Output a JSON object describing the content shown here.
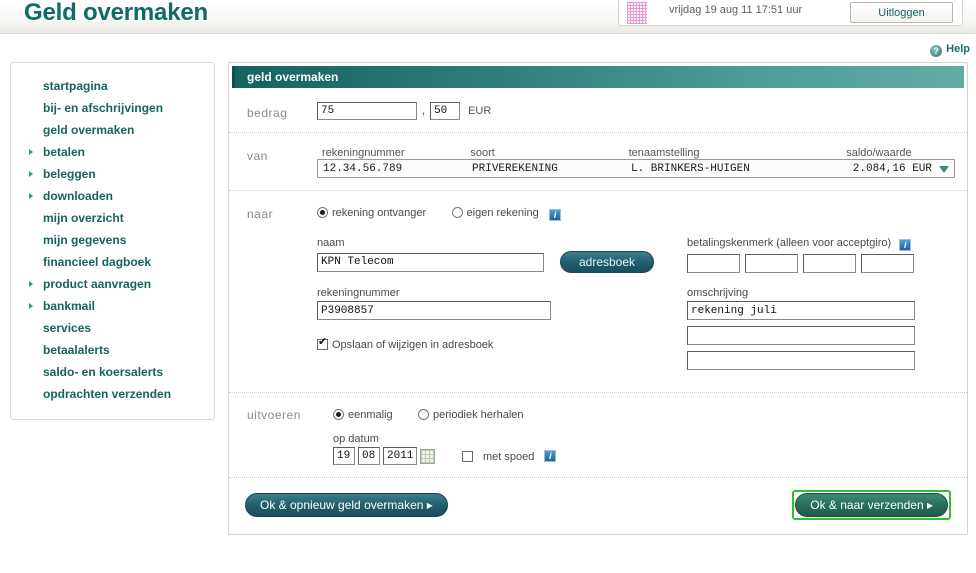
{
  "header": {
    "page_title": "Geld overmaken",
    "session_date": "vrijdag 19 aug 11 17:51 uur",
    "logout_label": "Uitloggen",
    "grid_icon": "grid-icon"
  },
  "help": {
    "label": "Help",
    "icon": "question-mark-icon",
    "glyph": "?"
  },
  "sidebar": {
    "items": [
      {
        "label": "startpagina",
        "has_caret": false
      },
      {
        "label": "bij- en afschrijvingen",
        "has_caret": false
      },
      {
        "label": "geld overmaken",
        "has_caret": false
      },
      {
        "label": "betalen",
        "has_caret": true
      },
      {
        "label": "beleggen",
        "has_caret": true
      },
      {
        "label": "downloaden",
        "has_caret": true
      },
      {
        "label": "mijn overzicht",
        "has_caret": false
      },
      {
        "label": "mijn gegevens",
        "has_caret": false
      },
      {
        "label": "financieel dagboek",
        "has_caret": false
      },
      {
        "label": "product aanvragen",
        "has_caret": true
      },
      {
        "label": "bankmail",
        "has_caret": true
      },
      {
        "label": "services",
        "has_caret": false
      },
      {
        "label": "betaalalerts",
        "has_caret": false
      },
      {
        "label": "saldo- en koersalerts",
        "has_caret": false
      },
      {
        "label": "opdrachten verzenden",
        "has_caret": false
      }
    ]
  },
  "panel": {
    "title": "geld overmaken",
    "bedrag": {
      "label": "bedrag",
      "euros": "75",
      "cents": "50",
      "currency": "EUR"
    },
    "van": {
      "label": "van",
      "columns": [
        "rekeningnummer",
        "soort",
        "tenaamstelling",
        "saldo/waarde"
      ],
      "account_number": "12.34.56.789",
      "account_type": "PRIVEREKENING",
      "account_holder": "L. BRINKERS-HUIGEN",
      "balance": "2.084,16 EUR",
      "dropdown_icon": "chevron-down-icon"
    },
    "naar": {
      "label": "naar",
      "radio_receiver": "rekening ontvanger",
      "radio_own": "eigen rekening",
      "selected": "rekening ontvanger",
      "naam_label": "naam",
      "naam_value": "KPN Telecom",
      "adresboek_label": "adresboek",
      "rekeningnummer_label": "rekeningnummer",
      "rekeningnummer_value": "P3908857",
      "opslaan_label": "Opslaan of wijzigen in adresboek",
      "opslaan_checked": true,
      "betalingskenmerk_label": "betalingskenmerk (alleen voor acceptgiro)",
      "betalingskenmerk_values": [
        "",
        "",
        "",
        ""
      ],
      "omschrijving_label": "omschrijving",
      "omschrijving_values": [
        "rekening juli",
        "",
        ""
      ],
      "info_icon": "info-icon",
      "info_glyph": "i"
    },
    "uitvoeren": {
      "label": "uitvoeren",
      "radio_once": "eenmalig",
      "radio_periodic": "periodiek herhalen",
      "selected": "eenmalig",
      "op_datum_label": "op datum",
      "day": "19",
      "month": "08",
      "year": "2011",
      "calendar_icon": "calendar-icon",
      "met_spoed_label": "met spoed",
      "met_spoed_checked": false
    },
    "buttons": {
      "left_label": "Ok & opnieuw geld overmaken  ▸",
      "right_label": "Ok & naar verzenden  ▸"
    }
  },
  "colors": {
    "brand_teal": "#116a66",
    "header_gradient_start": "#14635f",
    "focus_green": "#2ec22e",
    "button_blue": "#235f6e",
    "button_green": "#27705c"
  }
}
